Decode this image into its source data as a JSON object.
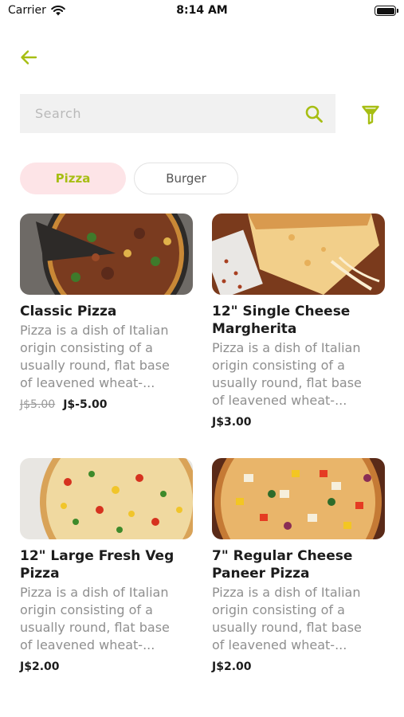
{
  "status_bar": {
    "carrier": "Carrier",
    "time": "8:14 AM"
  },
  "search": {
    "placeholder": "Search",
    "value": ""
  },
  "categories": [
    {
      "label": "Pizza",
      "active": true
    },
    {
      "label": "Burger",
      "active": false
    }
  ],
  "products": [
    {
      "title": "Classic Pizza",
      "description": [
        "Pizza is a dish of Italian",
        "origin consisting of a",
        "usually round, flat base",
        "of leavened wheat-..."
      ],
      "old_price": "J$5.00",
      "price": "J$-5.00"
    },
    {
      "title_lines": [
        "12\" Single Cheese",
        "Margherita"
      ],
      "description": [
        "Pizza is a dish of Italian",
        "origin consisting of a",
        "usually round, flat base",
        "of leavened wheat-..."
      ],
      "price": "J$3.00"
    },
    {
      "title_lines": [
        "12\" Large Fresh Veg",
        "Pizza"
      ],
      "description": [
        "Pizza is a dish of Italian",
        "origin consisting of a",
        "usually round, flat base",
        "of leavened wheat-..."
      ],
      "price": "J$2.00"
    },
    {
      "title_lines": [
        "7\" Regular Cheese",
        "Paneer Pizza"
      ],
      "description": [
        "Pizza is a dish of Italian",
        "origin consisting of a",
        "usually round, flat base",
        "of leavened wheat-..."
      ],
      "price": "J$2.00"
    }
  ],
  "icons": {
    "back": "arrow-left-icon",
    "search": "search-icon",
    "filter": "filter-icon",
    "wifi": "wifi-icon",
    "battery": "battery-icon"
  },
  "colors": {
    "accent": "#a7be13",
    "chip_active_bg": "#fde4e7",
    "search_bg": "#f1f1f1"
  }
}
